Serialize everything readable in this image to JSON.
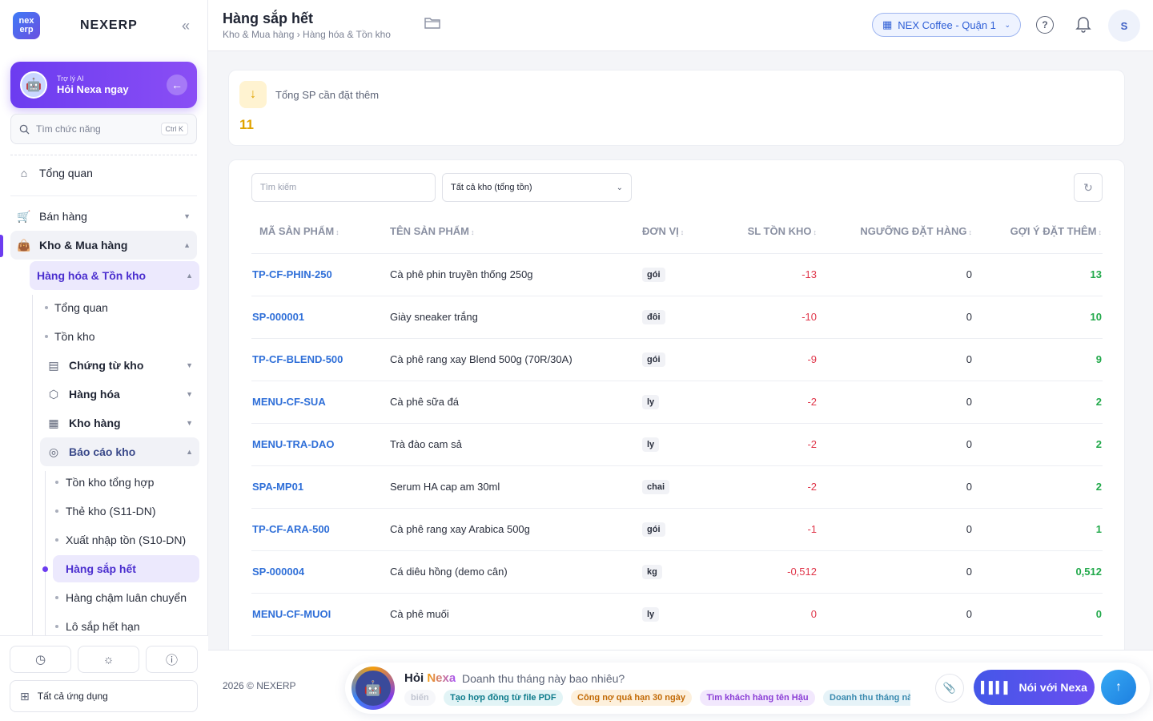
{
  "brand": {
    "logo_text_top": "nex",
    "logo_text_bottom": "erp",
    "name": "NEXERP"
  },
  "ai_card": {
    "subtitle": "Trợ lý AI",
    "title": "Hỏi Nexa ngay"
  },
  "sidebar": {
    "search_placeholder": "Tìm chức năng",
    "search_shortcut": "Ctrl K",
    "overview": "Tổng quan",
    "sales": "Bán hàng",
    "warehouse": "Kho & Mua hàng",
    "goods_inventory": "Hàng hóa & Tồn kho",
    "sub_overview": "Tổng quan",
    "sub_stock": "Tồn kho",
    "vouchers": "Chứng từ kho",
    "goods": "Hàng hóa",
    "warehouses": "Kho hàng",
    "reports": "Báo cáo kho",
    "report_items": [
      "Tồn kho tổng hợp",
      "Thẻ kho (S11-DN)",
      "Xuất nhập tồn (S10-DN)",
      "Hàng sắp hết",
      "Hàng chậm luân chuyển",
      "Lô sắp hết hạn"
    ],
    "all_apps": "Tất cả ứng dụng"
  },
  "header": {
    "title": "Hàng sắp hết",
    "breadcrumb": "Kho & Mua hàng › Hàng hóa & Tồn kho",
    "store": "NEX Coffee - Quận 1",
    "avatar": "S"
  },
  "summary": {
    "label": "Tổng SP cần đặt thêm",
    "value": "11"
  },
  "filters": {
    "search_placeholder": "Tìm kiếm",
    "warehouse_select": "Tất cả kho (tổng tồn)"
  },
  "table": {
    "headers": [
      "MÃ SẢN PHẨM",
      "TÊN SẢN PHẨM",
      "ĐƠN VỊ",
      "SL TỒN KHO",
      "NGƯỠNG ĐẶT HÀNG",
      "GỢI Ý ĐẶT THÊM"
    ],
    "rows": [
      {
        "code": "TP-CF-PHIN-250",
        "name": "Cà phê phin truyền thống 250g",
        "unit": "gói",
        "stock": "-13",
        "threshold": "0",
        "suggest": "13"
      },
      {
        "code": "SP-000001",
        "name": "Giày sneaker trắng",
        "unit": "đôi",
        "stock": "-10",
        "threshold": "0",
        "suggest": "10"
      },
      {
        "code": "TP-CF-BLEND-500",
        "name": "Cà phê rang xay Blend 500g (70R/30A)",
        "unit": "gói",
        "stock": "-9",
        "threshold": "0",
        "suggest": "9"
      },
      {
        "code": "MENU-CF-SUA",
        "name": "Cà phê sữa đá",
        "unit": "ly",
        "stock": "-2",
        "threshold": "0",
        "suggest": "2"
      },
      {
        "code": "MENU-TRA-DAO",
        "name": "Trà đào cam sả",
        "unit": "ly",
        "stock": "-2",
        "threshold": "0",
        "suggest": "2"
      },
      {
        "code": "SPA-MP01",
        "name": "Serum HA cap am 30ml",
        "unit": "chai",
        "stock": "-2",
        "threshold": "0",
        "suggest": "2"
      },
      {
        "code": "TP-CF-ARA-500",
        "name": "Cà phê rang xay Arabica 500g",
        "unit": "gói",
        "stock": "-1",
        "threshold": "0",
        "suggest": "1"
      },
      {
        "code": "SP-000004",
        "name": "Cá diêu hồng (demo cân)",
        "unit": "kg",
        "stock": "-0,512",
        "threshold": "0",
        "suggest": "0,512"
      },
      {
        "code": "MENU-CF-MUOI",
        "name": "Cà phê muối",
        "unit": "ly",
        "stock": "0",
        "threshold": "0",
        "suggest": "0"
      }
    ]
  },
  "footer": {
    "copyright": "2026 © NEXERP",
    "nexa_prefix": "Hỏi",
    "nexa_name": "Nexa",
    "nexa_question": "Doanh thu tháng này bao nhiêu?",
    "chips": [
      "biến",
      "Tạo hợp đồng từ file PDF",
      "Công nợ quá hạn 30 ngày",
      "Tìm khách hàng tên Hậu",
      "Doanh thu tháng này"
    ],
    "talk_button": "Nói với Nexa"
  }
}
